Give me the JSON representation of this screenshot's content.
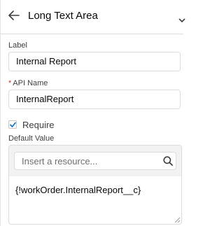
{
  "header": {
    "title": "Long Text Area"
  },
  "fields": {
    "label": {
      "label": "Label",
      "value": "Internal Report"
    },
    "api_name": {
      "required_marker": "*",
      "label": "API Name",
      "value": "InternalReport"
    },
    "require": {
      "label": "Require",
      "checked": true
    },
    "default_value": {
      "label": "Default Value",
      "placeholder": "Insert a resource...",
      "value": "{!workOrder.InternalReport__c}"
    }
  },
  "colors": {
    "accent": "#0070d2",
    "required": "#c23934",
    "border": "#dddbda"
  },
  "icons": [
    "back-arrow-icon",
    "chevron-down-icon",
    "checkmark-icon",
    "search-icon",
    "resize-grip-icon"
  ]
}
